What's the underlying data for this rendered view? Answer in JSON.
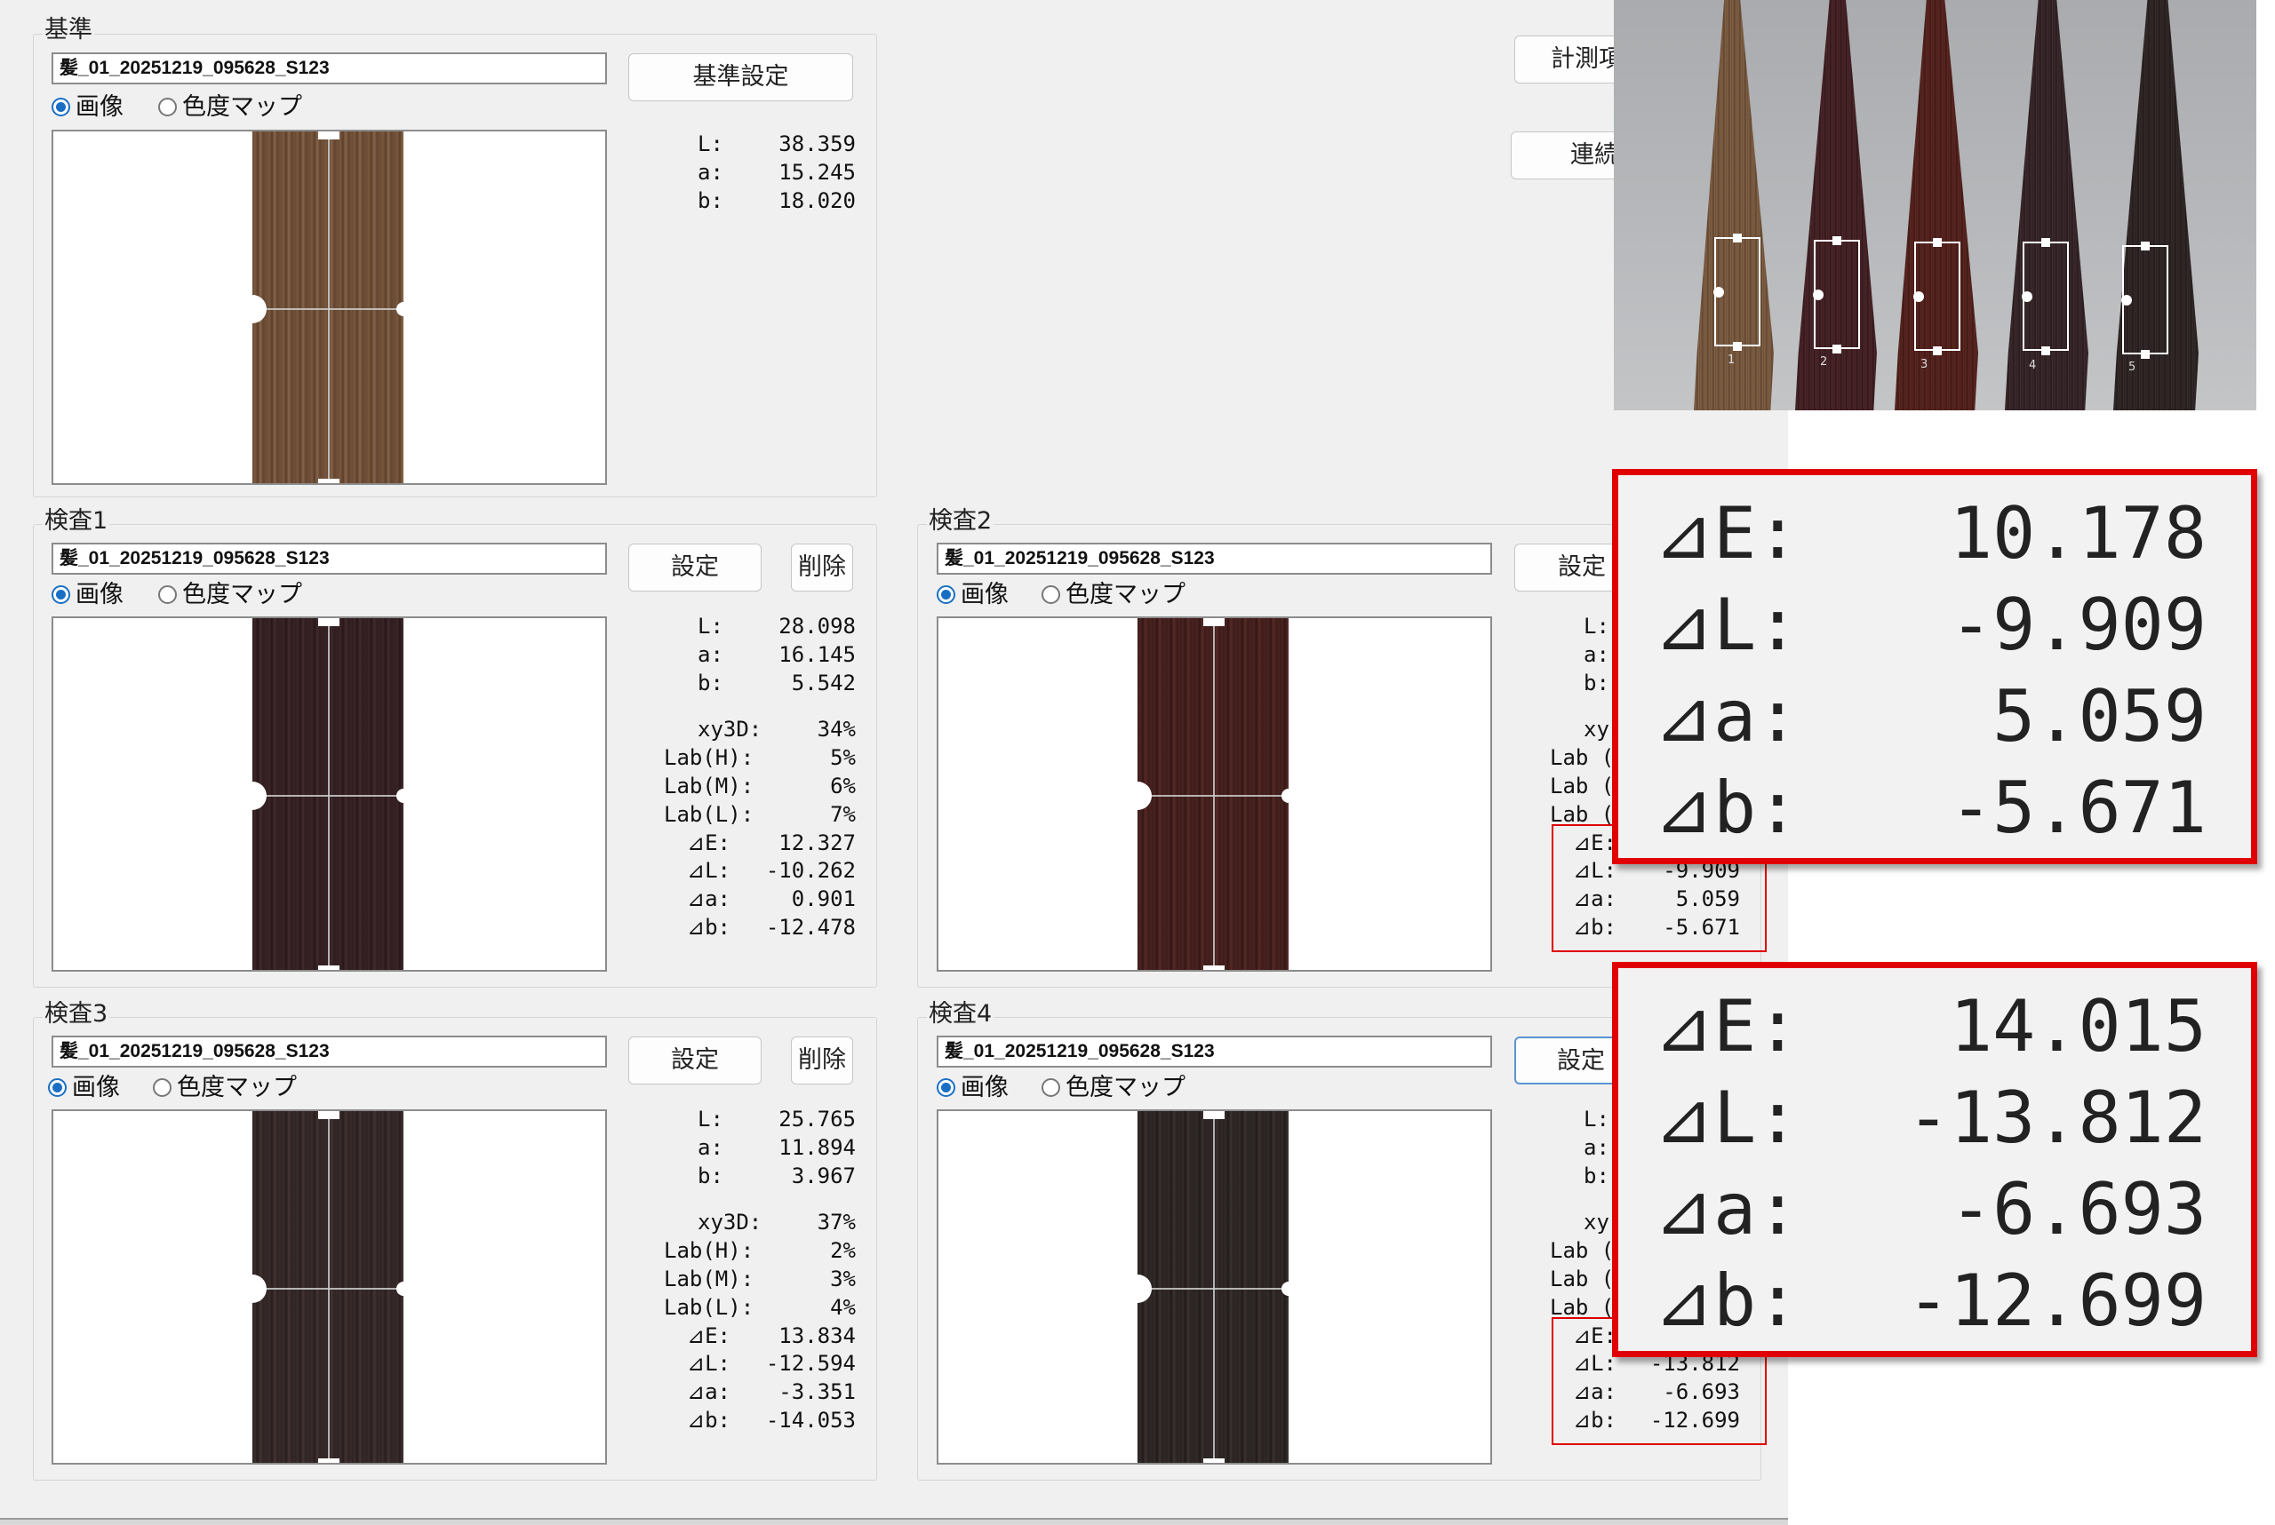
{
  "colors": {
    "accent": "#1a6fc4",
    "highlight": "#e00000",
    "panel": "#f0f0f0"
  },
  "reference": {
    "title": "基準",
    "file": "髪_01_20251219_095628_S123",
    "set_button": "基準設定",
    "radio_image": "画像",
    "radio_map": "色度マップ",
    "selected_view": "画像",
    "L": "38.359",
    "a": "15.245",
    "b": "18.020"
  },
  "right_buttons": {
    "measure_label": "計測項",
    "continuous_label": "連続"
  },
  "labels": {
    "L": "L:",
    "a": "a:",
    "b": "b:",
    "xy3d": "xy3D:",
    "lab_h": "Lab(H):",
    "lab_m": "Lab(M):",
    "lab_l": "Lab(L):",
    "dE": "⊿E:",
    "dL": "⊿L:",
    "da": "⊿a:",
    "db": "⊿b:",
    "set": "設定",
    "delete": "削除"
  },
  "inspections": [
    {
      "title": "検査1",
      "file": "髪_01_20251219_095628_S123",
      "radio_image": "画像",
      "radio_map": "色度マップ",
      "selected_view": "画像",
      "L": "28.098",
      "a": "16.145",
      "b": "5.542",
      "xy3d": "34%",
      "lab_h": "5%",
      "lab_m": "6%",
      "lab_l": "7%",
      "dE": "12.327",
      "dL": "-10.262",
      "da": "0.901",
      "db": "-12.478"
    },
    {
      "title": "検査2",
      "file": "髪_01_20251219_095628_S123",
      "radio_image": "画像",
      "radio_map": "色度マップ",
      "selected_view": "画像",
      "visible_labels": [
        "L:",
        "a:",
        "b:",
        "xy",
        "Lab (",
        "Lab (",
        "Lab (",
        "⊿E:",
        "⊿L:",
        "⊿a:",
        "⊿b:"
      ],
      "dL": "-9.909",
      "da": "5.059",
      "db": "-5.671"
    },
    {
      "title": "検査3",
      "file": "髪_01_20251219_095628_S123",
      "radio_image": "画像",
      "radio_map": "色度マップ",
      "selected_view": "画像",
      "L": "25.765",
      "a": "11.894",
      "b": "3.967",
      "xy3d": "37%",
      "lab_h": "2%",
      "lab_m": "3%",
      "lab_l": "4%",
      "dE": "13.834",
      "dL": "-12.594",
      "da": "-3.351",
      "db": "-14.053"
    },
    {
      "title": "検査4",
      "file": "髪_01_20251219_095628_S123",
      "radio_image": "画像",
      "radio_map": "色度マップ",
      "selected_view": "画像",
      "visible_labels": [
        "L:",
        "a:",
        "b:",
        "xy",
        "Lab (",
        "Lab (",
        "Lab (",
        "⊿E:",
        "⊿L:",
        "⊿a:",
        "⊿b:"
      ],
      "dL": "-13.812",
      "da": "-6.693",
      "db": "-12.699"
    }
  ],
  "photo": {
    "sample_numbers": [
      "1",
      "2",
      "3",
      "4",
      "5"
    ]
  },
  "zoom1": {
    "dE": "10.178",
    "dL": "-9.909",
    "da": "5.059",
    "db": "-5.671"
  },
  "zoom2": {
    "dE": "14.015",
    "dL": "-13.812",
    "da": "-6.693",
    "db": "-12.699"
  }
}
